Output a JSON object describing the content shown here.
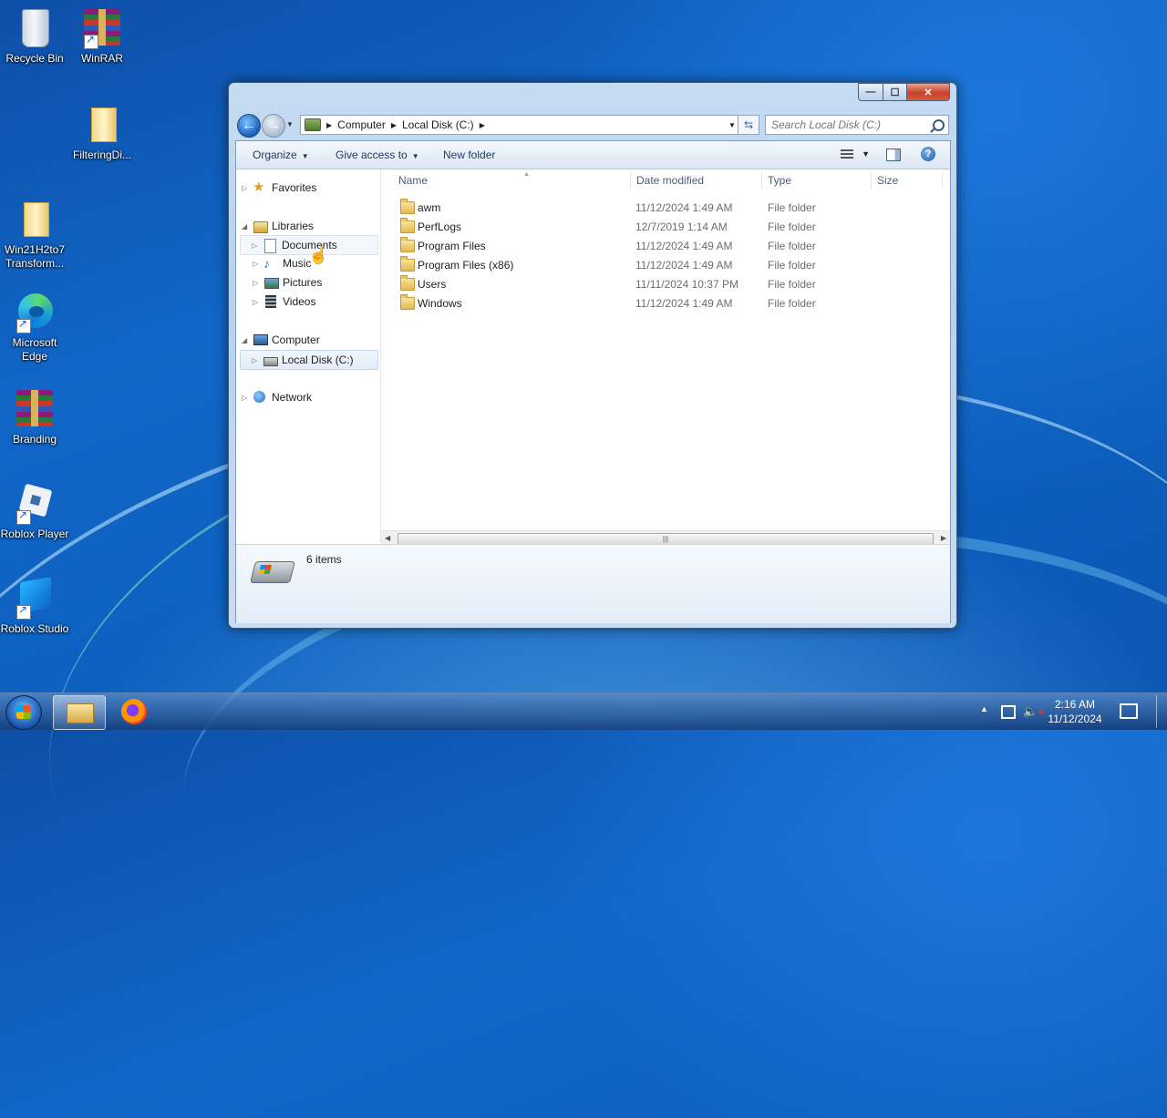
{
  "desktop": {
    "icons": [
      {
        "label": "Recycle Bin"
      },
      {
        "label": "WinRAR"
      },
      {
        "label": "FilteringDi..."
      },
      {
        "label": "Win21H2to7 Transform..."
      },
      {
        "label": "Microsoft Edge"
      },
      {
        "label": "Branding"
      },
      {
        "label": "Roblox Player"
      },
      {
        "label": "Roblox Studio"
      }
    ]
  },
  "window": {
    "controls": {
      "minimize": "—",
      "maximize": "☐",
      "close": "✕"
    },
    "address": {
      "crumbs": [
        "Computer",
        "Local Disk (C:)"
      ]
    },
    "search": {
      "placeholder": "Search Local Disk (C:)"
    },
    "toolbar": {
      "organize": "Organize",
      "give_access": "Give access to",
      "new_folder": "New folder"
    },
    "nav": {
      "favorites": "Favorites",
      "libraries": "Libraries",
      "documents": "Documents",
      "music": "Music",
      "pictures": "Pictures",
      "videos": "Videos",
      "computer": "Computer",
      "local_disk": "Local Disk (C:)",
      "network": "Network"
    },
    "columns": {
      "name": "Name",
      "date": "Date modified",
      "type": "Type",
      "size": "Size"
    },
    "files": [
      {
        "name": "awm",
        "date": "11/12/2024 1:49 AM",
        "type": "File folder"
      },
      {
        "name": "PerfLogs",
        "date": "12/7/2019 1:14 AM",
        "type": "File folder"
      },
      {
        "name": "Program Files",
        "date": "11/12/2024 1:49 AM",
        "type": "File folder"
      },
      {
        "name": "Program Files (x86)",
        "date": "11/12/2024 1:49 AM",
        "type": "File folder"
      },
      {
        "name": "Users",
        "date": "11/11/2024 10:37 PM",
        "type": "File folder"
      },
      {
        "name": "Windows",
        "date": "11/12/2024 1:49 AM",
        "type": "File folder"
      }
    ],
    "details": {
      "count": "6 items"
    }
  },
  "taskbar": {
    "clock": {
      "time": "2:16 AM",
      "date": "11/12/2024"
    }
  },
  "icons": [
    "recycle-bin-icon",
    "winrar-icon",
    "folder-icon",
    "edge-icon",
    "roblox-icon",
    "star-icon",
    "library-icon",
    "computer-icon",
    "drive-icon",
    "network-icon",
    "search-icon",
    "help-icon",
    "firefox-icon",
    "windows-flag-icon"
  ]
}
